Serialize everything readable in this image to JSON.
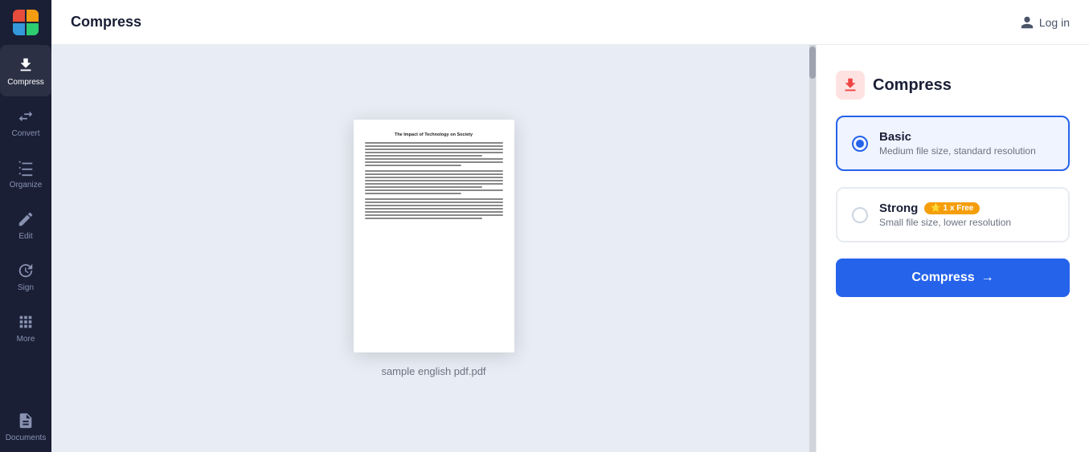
{
  "app": {
    "title": "Compress",
    "logo_colors": [
      "#e74c3c",
      "#f39c12",
      "#3498db",
      "#2ecc71"
    ]
  },
  "header": {
    "title": "Compress",
    "login_label": "Log in"
  },
  "sidebar": {
    "items": [
      {
        "id": "compress",
        "label": "Compress",
        "active": true
      },
      {
        "id": "convert",
        "label": "Convert",
        "active": false
      },
      {
        "id": "organize",
        "label": "Organize",
        "active": false
      },
      {
        "id": "edit",
        "label": "Edit",
        "active": false
      },
      {
        "id": "sign",
        "label": "Sign",
        "active": false
      },
      {
        "id": "more",
        "label": "More",
        "active": false
      },
      {
        "id": "documents",
        "label": "Documents",
        "active": false
      }
    ]
  },
  "preview": {
    "filename": "sample english pdf.pdf",
    "pdf_title": "The Impact of Technology on Society"
  },
  "panel": {
    "title": "Compress",
    "options": [
      {
        "id": "basic",
        "name": "Basic",
        "description": "Medium file size, standard resolution",
        "selected": true,
        "badge": null
      },
      {
        "id": "strong",
        "name": "Strong",
        "description": "Small file size, lower resolution",
        "selected": false,
        "badge": "⭐ 1 x Free"
      }
    ],
    "compress_button_label": "Compress",
    "compress_button_arrow": "→"
  }
}
